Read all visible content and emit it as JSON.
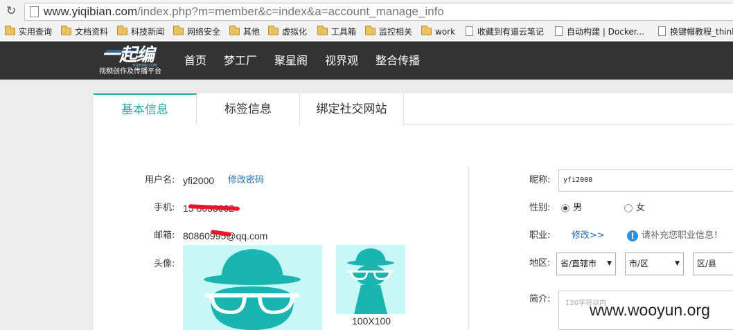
{
  "browser": {
    "url_host": "www.yiqibian.com",
    "url_rest": "/index.php?m=member&c=index&a=account_manage_info"
  },
  "bookmarks": [
    {
      "label": "实用查询",
      "type": "folder"
    },
    {
      "label": "文档资料",
      "type": "folder"
    },
    {
      "label": "科技新闻",
      "type": "folder"
    },
    {
      "label": "网络安全",
      "type": "folder"
    },
    {
      "label": "其他",
      "type": "folder"
    },
    {
      "label": "虚拟化",
      "type": "folder"
    },
    {
      "label": "工具箱",
      "type": "folder"
    },
    {
      "label": "监控相关",
      "type": "folder"
    },
    {
      "label": "work",
      "type": "folder"
    },
    {
      "label": "收藏到有道云笔记",
      "type": "page"
    },
    {
      "label": "自动构建 | Docker...",
      "type": "page"
    },
    {
      "label": "换键帽教程_think",
      "type": "page"
    }
  ],
  "site": {
    "logo_text": "一起编",
    "logo_en": "YIQIBIAN.COM",
    "logo_sub": "视频创作及传播平台",
    "nav": [
      "首页",
      "梦工厂",
      "聚星阁",
      "视界观",
      "整合传播"
    ]
  },
  "tabs": [
    "基本信息",
    "标签信息",
    "绑定社交网站"
  ],
  "profile": {
    "username_label": "用户名:",
    "username": "yfi2000",
    "change_password": "修改密码",
    "phone_label": "手机:",
    "phone": "15   8033662",
    "email_label": "邮箱:",
    "email": "80860995@qq.com",
    "avatar_label": "头像:",
    "avatar_small_caption": "100X100"
  },
  "form": {
    "nickname_label": "昵称:",
    "nickname_value": "yfi2000",
    "gender_label": "性别:",
    "gender_male": "男",
    "gender_female": "女",
    "job_label": "职业:",
    "job_edit": "修改>>",
    "job_hint": "请补充您职业信息！",
    "region_label": "地区:",
    "province": "省/直辖市",
    "city": "市/区",
    "district": "区/县",
    "intro_label": "简介:",
    "intro_placeholder": "120字符以内"
  },
  "watermark": "www.wooyun.org",
  "colors": {
    "accent": "#1fa8a4",
    "link": "#1e6fb8",
    "nav_bg": "#333333",
    "avatar_bg": "#c8f7f7",
    "avatar_fg": "#1ab5b0"
  }
}
